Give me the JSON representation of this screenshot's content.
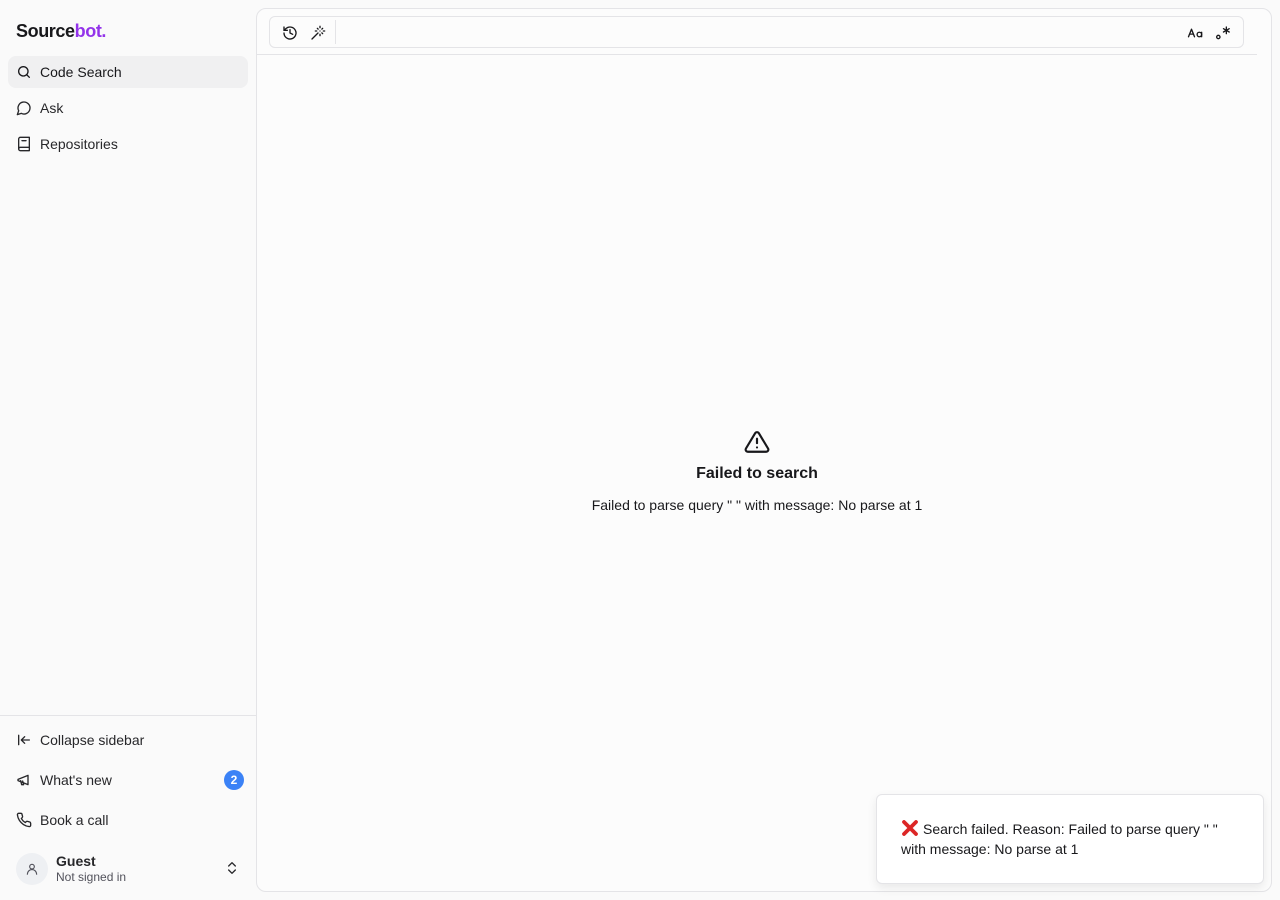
{
  "sidebar": {
    "logo": {
      "main": "Source",
      "accent": "bot."
    },
    "nav": [
      {
        "label": "Code Search",
        "icon": "search-icon",
        "active": true
      },
      {
        "label": "Ask",
        "icon": "chat-bubble-icon",
        "active": false
      },
      {
        "label": "Repositories",
        "icon": "book-icon",
        "active": false
      }
    ],
    "bottom": [
      {
        "label": "Collapse sidebar",
        "icon": "collapse-left-icon"
      },
      {
        "label": "What's new",
        "icon": "megaphone-icon",
        "badge": "2"
      },
      {
        "label": "Book a call",
        "icon": "phone-icon"
      }
    ],
    "user": {
      "name": "Guest",
      "status": "Not signed in"
    }
  },
  "search_bar": {
    "value": "",
    "left_icons": [
      "history-icon",
      "magic-wand-icon"
    ],
    "right_icons": [
      "case-sensitive-icon",
      "regex-icon"
    ]
  },
  "error": {
    "title": "Failed to search",
    "message": "Failed to parse query \" \" with message: No parse at 1"
  },
  "toast": {
    "icon": "red-x-icon",
    "message": "Search failed. Reason: Failed to parse query \" \" with message: No parse at 1"
  },
  "colors": {
    "brand_accent": "#9333ea",
    "badge": "#3b82f6",
    "error_x": "#dc2626"
  }
}
